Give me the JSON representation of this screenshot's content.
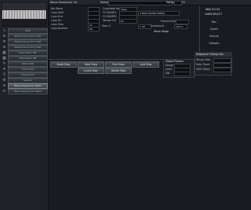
{
  "sidebar": {
    "items": [
      {
        "label": "Mdk",
        "icon": "wave-icon"
      },
      {
        "label": "Performance Ctrl 1 INT",
        "icon": "fader-icon"
      },
      {
        "label": "Performance Ctrl 2 INT",
        "icon": "fader-icon"
      },
      {
        "label": "Performance Ctrl 3 INT",
        "icon": "fader-icon"
      },
      {
        "label": "Patch Bank INT",
        "icon": "grid-icon"
      },
      {
        "label": "Patch Bank INT",
        "icon": "grid-icon"
      },
      {
        "label": "Patch Edit",
        "icon": "pencil-icon"
      },
      {
        "label": "FX/FX Edit",
        "icon": "fx-icon"
      },
      {
        "label": "Mixer/Limit",
        "icon": "mixer-icon"
      },
      {
        "label": "System",
        "icon": "gear-icon"
      },
      {
        "label": "Wave Sequencer WAV1",
        "icon": "sequence-icon"
      },
      {
        "label": "Wave Sequencer WAV2",
        "icon": "sequence-icon"
      }
    ],
    "active_index": 10
  },
  "topbar": {
    "title": "Wave Sequencer Int",
    "name_label": "Name",
    "wave_label": "Wave#",
    "wave_value": "01"
  },
  "params_left": [
    {
      "label": "Bst Wave",
      "value": ""
    },
    {
      "label": "Loop Start",
      "value": ""
    },
    {
      "label": "Loop End",
      "value": ""
    },
    {
      "label": "Loop Dir",
      "value": ""
    },
    {
      "label": "Loop Step",
      "value": "11"
    },
    {
      "label": "Loop Number",
      "value": "00"
    }
  ],
  "params_mid": [
    {
      "label": "Crossfade Rate",
      "value": "Waig"
    },
    {
      "label": "FX SHAPE1",
      "value": ""
    },
    {
      "label": "FX SHAPE2",
      "value": ""
    },
    {
      "label": "Tempo Ctrl",
      "value": "tm"
    }
  ],
  "params_right": [
    {
      "label": "",
      "value": "4 BAR CHORD FREQS"
    },
    {
      "label": "Forced Entry",
      "value": ""
    },
    {
      "label": "Step #",
      "value": "1 UK"
    },
    {
      "label": "Compound",
      "value": "100 %"
    }
  ],
  "wave_stage_label": "Wave Stage",
  "right_panel": {
    "header": "WAV 02174",
    "subheader": "CARD SELECT",
    "buttons": [
      "Rec",
      "Synth",
      "Source",
      "Sample"
    ]
  },
  "action_buttons": {
    "row1": [
      "Paste Step",
      "Next Step",
      "Prev Step",
      "Last Step"
    ],
    "row2": [
      "Insert Step",
      "Delete Step"
    ]
  },
  "global_params": {
    "header": "Global Params",
    "rows": [
      {
        "label": "Range",
        "value": ""
      },
      {
        "label": "Lead",
        "value": ""
      },
      {
        "label": "Dst",
        "value": ""
      }
    ]
  },
  "sequence_timing": {
    "header": "Sequence Timing Info",
    "rows": [
      {
        "label": "Tempo Mod",
        "value": ""
      },
      {
        "label": "Rate Timer",
        "value": ""
      },
      {
        "label": "MOD Mode",
        "value": ""
      }
    ]
  }
}
